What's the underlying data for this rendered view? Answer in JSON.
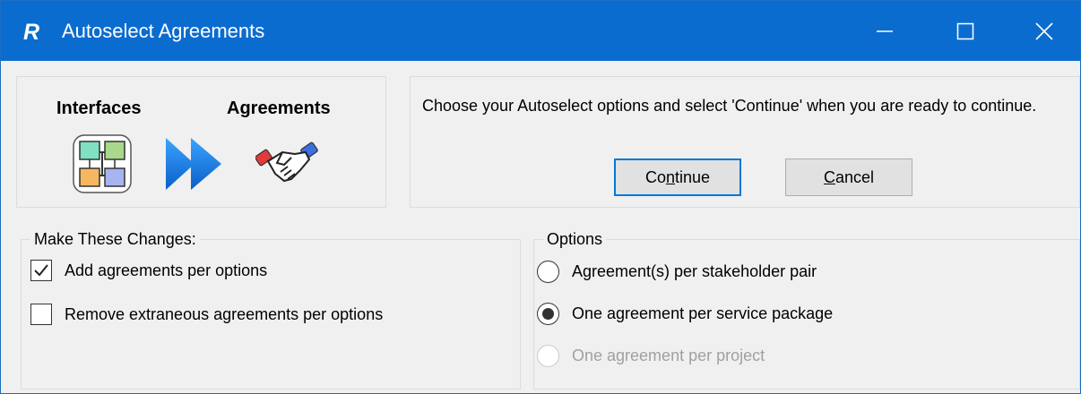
{
  "window": {
    "title": "Autoselect Agreements",
    "app_icon_letter": "R",
    "controls": [
      "minimize-icon",
      "maximize-icon",
      "close-icon"
    ]
  },
  "images_panel": {
    "interfaces_label": "Interfaces",
    "agreements_label": "Agreements"
  },
  "message_panel": {
    "text": "Choose your Autoselect options and select 'Continue' when you are ready to continue.",
    "continue_pre": "Co",
    "continue_u": "n",
    "continue_post": "tinue",
    "cancel_u": "C",
    "cancel_post": "ancel"
  },
  "changes_group": {
    "title": "Make These Changes:",
    "items": [
      {
        "label": "Add agreements per options",
        "checked": true
      },
      {
        "label": "Remove extraneous agreements per options",
        "checked": false
      }
    ]
  },
  "options_group": {
    "title": "Options",
    "items": [
      {
        "label": "Agreement(s) per stakeholder pair",
        "selected": false,
        "enabled": true
      },
      {
        "label": "One agreement per service package",
        "selected": true,
        "enabled": true
      },
      {
        "label": "One agreement per project",
        "selected": false,
        "enabled": false
      }
    ]
  },
  "colors": {
    "titlebar": "#0b6cd0",
    "default_button_border": "#0078d7",
    "disabled_text": "#a0a0a0"
  }
}
